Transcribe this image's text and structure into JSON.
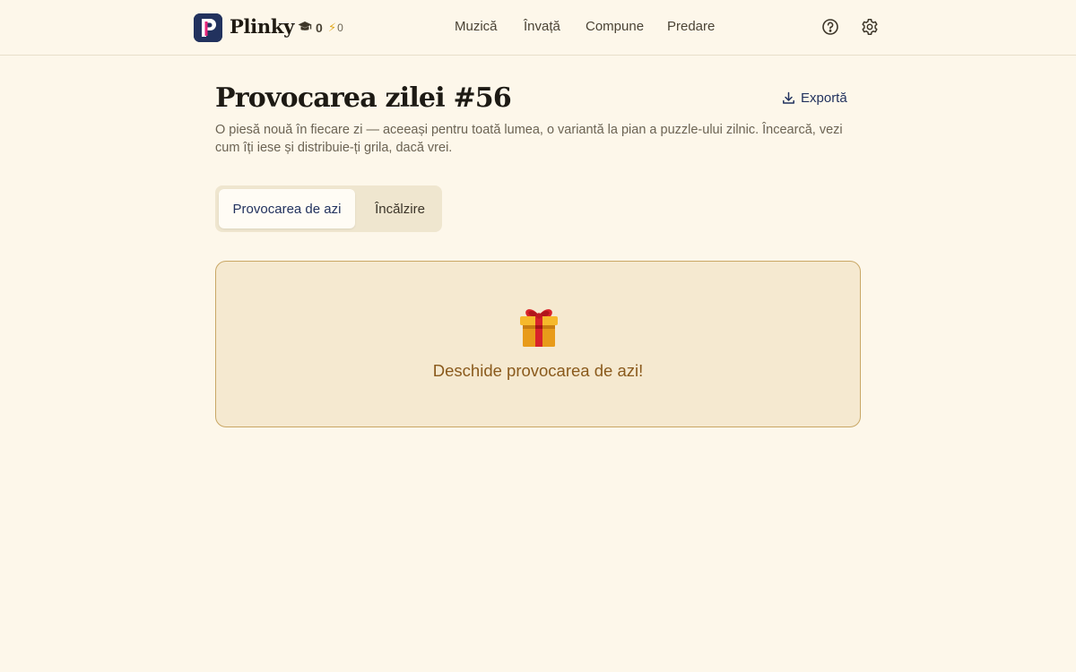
{
  "app": {
    "name": "Plinky",
    "brand_color": "#22325e",
    "accent_color": "#e4257a"
  },
  "header": {
    "stats": {
      "graduation_icon": "graduation-cap-icon",
      "lessons_count": "0",
      "bolt_icon": "lightning-bolt-icon",
      "streak_count": "0"
    },
    "nav": [
      "Muzică",
      "Învață",
      "Compune",
      "Predare"
    ],
    "icons": [
      "help-circle-icon",
      "gear-icon"
    ]
  },
  "main": {
    "title": "Provocarea zilei #56",
    "export_label": "Exportă",
    "export_icon": "download-icon",
    "subtitle": "O piesă nouă în fiecare zi — aceeași pentru toată lumea, o variantă la pian a puzzle-ului zilnic. Încearcă, vezi cum îți iese și distribuie-ți grila, dacă vrei.",
    "tabs": [
      {
        "label": "Provocarea de azi",
        "active": true
      },
      {
        "label": "Încălzire",
        "active": false
      }
    ],
    "card": {
      "icon": "gift-icon",
      "label": "Deschide provocarea de azi!",
      "background": "#f5e9d0",
      "border": "#c9a765",
      "text_color": "#8a5a1c"
    }
  }
}
